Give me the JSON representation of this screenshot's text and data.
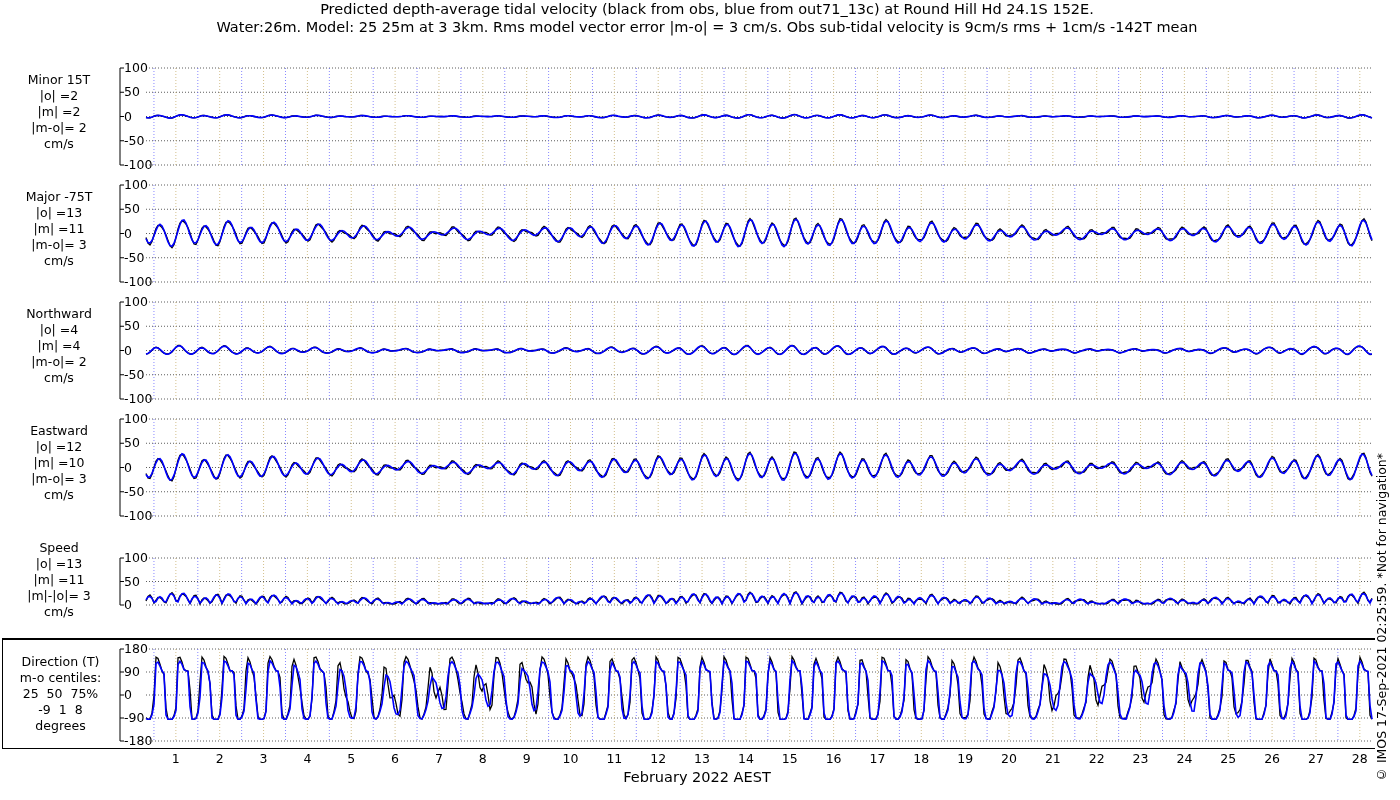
{
  "title": [
    "Predicted depth-average tidal velocity (black from obs, blue from out71_13c) at Round Hill Hd 24.1S 152E.",
    "Water:26m. Model: 25 25m at 3 3km. Rms model vector error |m-o| = 3 cm/s. Obs sub-tidal velocity is 9cm/s rms + 1cm/s -142T mean"
  ],
  "panels": [
    {
      "kind": "minor",
      "label_lines": [
        "Minor 15T",
        "|o| =2",
        "|m| =2",
        "|m-o|= 2",
        "cm/s"
      ],
      "yticks": [
        "100",
        "50",
        "0",
        "-50",
        "-100"
      ]
    },
    {
      "kind": "major",
      "label_lines": [
        "Major -75T",
        "|o| =13",
        "|m| =11",
        "|m-o|= 3",
        "cm/s"
      ],
      "yticks": [
        "100",
        "50",
        "0",
        "-50",
        "-100"
      ]
    },
    {
      "kind": "northward",
      "label_lines": [
        "Northward",
        "|o| =4",
        "|m| =4",
        "|m-o|= 2",
        "cm/s"
      ],
      "yticks": [
        "100",
        "50",
        "0",
        "-50",
        "-100"
      ]
    },
    {
      "kind": "eastward",
      "label_lines": [
        "Eastward",
        "|o| =12",
        "|m| =10",
        "|m-o|= 3",
        "cm/s"
      ],
      "yticks": [
        "100",
        "50",
        "0",
        "-50",
        "-100"
      ]
    },
    {
      "kind": "speed",
      "label_lines": [
        "Speed",
        "|o| =13",
        "|m| =11",
        "|m|-|o|= 3",
        "cm/s"
      ],
      "yticks": [
        "100",
        "50",
        "0"
      ]
    },
    {
      "kind": "direction",
      "label_lines": [
        "Direction (T)",
        "m-o centiles:",
        "25  50  75%",
        "-9  1  8",
        "degrees"
      ],
      "yticks": [
        "180",
        "90",
        "0",
        "-90",
        "-180"
      ]
    }
  ],
  "days": [
    "1",
    "2",
    "3",
    "4",
    "5",
    "6",
    "7",
    "8",
    "9",
    "10",
    "11",
    "12",
    "13",
    "14",
    "15",
    "16",
    "17",
    "18",
    "19",
    "20",
    "21",
    "22",
    "23",
    "24",
    "25",
    "26",
    "27",
    "28"
  ],
  "xlabel": "February 2022 AEST",
  "side_note": "© IMOS 17-Sep-2021 02:25:59. *Not for navigation*"
}
